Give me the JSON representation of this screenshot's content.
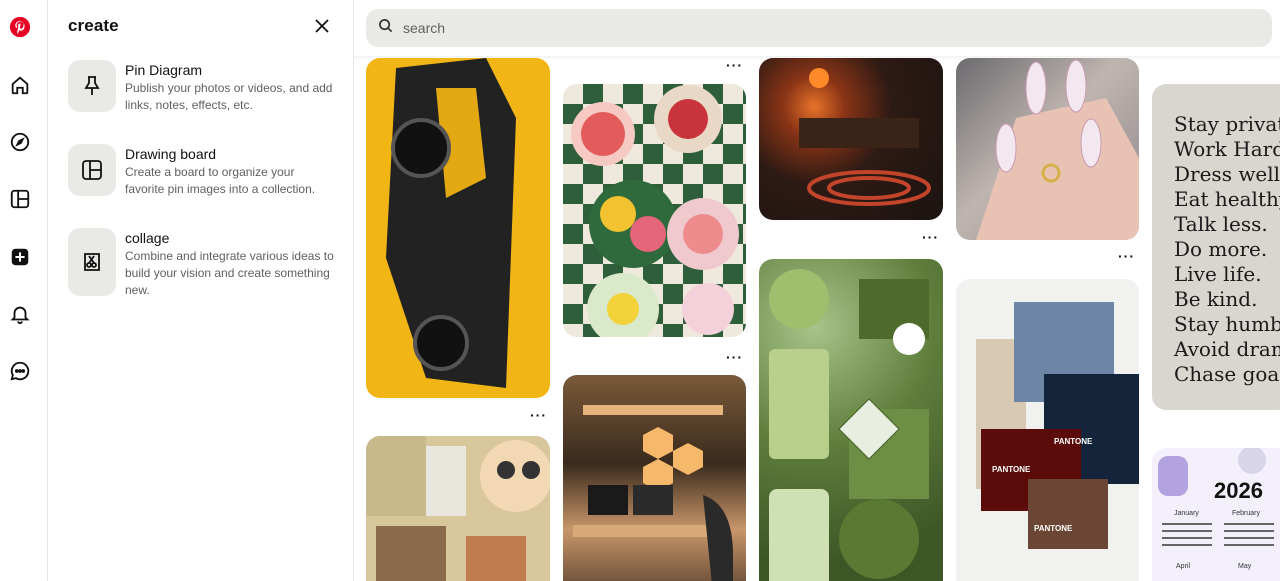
{
  "brand": {
    "accent": "#e60023"
  },
  "rail": {
    "items": [
      {
        "name": "pinterest-logo",
        "icon": "pinterest-logo"
      },
      {
        "name": "home",
        "icon": "home-icon"
      },
      {
        "name": "explore",
        "icon": "compass-icon"
      },
      {
        "name": "boards",
        "icon": "boards-icon"
      },
      {
        "name": "create",
        "icon": "plus-icon"
      },
      {
        "name": "notifications",
        "icon": "bell-icon"
      },
      {
        "name": "messages",
        "icon": "chat-icon"
      }
    ]
  },
  "panel": {
    "title": "create",
    "close_icon": "close-icon",
    "options": [
      {
        "title": "Pin Diagram",
        "description": "Publish your photos or videos, and add links, notes, effects, etc.",
        "icon": "pin-icon"
      },
      {
        "title": "Drawing board",
        "description": "Create a board to organize your favorite pin images into a collection.",
        "icon": "board-layout-icon"
      },
      {
        "title": "collage",
        "description": "Combine and integrate various ideas to build your vision and create something new.",
        "icon": "collage-icon"
      }
    ]
  },
  "search": {
    "placeholder": "search",
    "value": ""
  },
  "feed": {
    "more_label": "···",
    "quote_lines": [
      "Stay private.",
      "Work Hard.",
      "Dress well.",
      "Eat healthy.",
      "Talk less.",
      "Do more.",
      "Live life.",
      "Be kind.",
      "Stay humble",
      "Avoid drama",
      "Chase goals."
    ],
    "calendar": {
      "year": "2026",
      "months": [
        "January",
        "February",
        "April",
        "May"
      ]
    },
    "pantone": {
      "brand": "PANTONE",
      "swatches": [
        "PANTONE",
        "PANTONE",
        "PANTONE"
      ]
    }
  }
}
